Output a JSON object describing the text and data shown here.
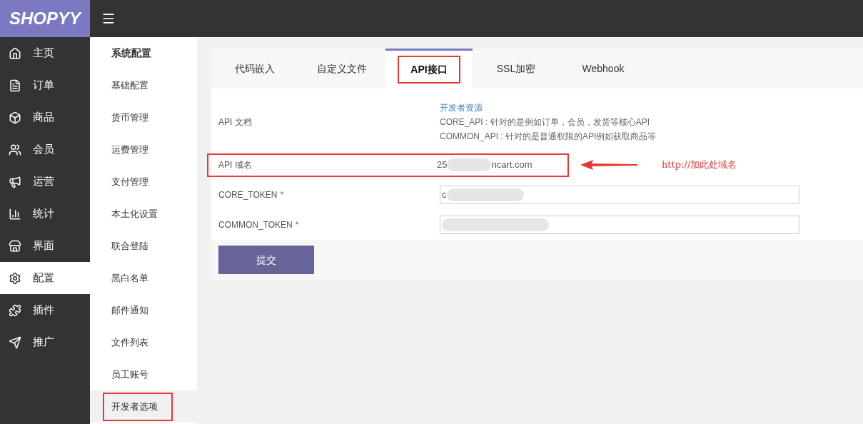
{
  "logo": "SHOPYY",
  "nav": [
    {
      "label": "主页",
      "selected": false
    },
    {
      "label": "订单",
      "selected": false
    },
    {
      "label": "商品",
      "selected": false
    },
    {
      "label": "会员",
      "selected": false
    },
    {
      "label": "运营",
      "selected": false
    },
    {
      "label": "统计",
      "selected": false
    },
    {
      "label": "界面",
      "selected": false
    },
    {
      "label": "配置",
      "selected": true
    },
    {
      "label": "插件",
      "selected": false
    },
    {
      "label": "推广",
      "selected": false
    }
  ],
  "submenu": {
    "title": "系统配置",
    "items": [
      {
        "label": "基础配置",
        "selected": false,
        "annotated": false
      },
      {
        "label": "货币管理",
        "selected": false,
        "annotated": false
      },
      {
        "label": "运费管理",
        "selected": false,
        "annotated": false
      },
      {
        "label": "支付管理",
        "selected": false,
        "annotated": false
      },
      {
        "label": "本土化设置",
        "selected": false,
        "annotated": false
      },
      {
        "label": "联合登陆",
        "selected": false,
        "annotated": false
      },
      {
        "label": "黑白名单",
        "selected": false,
        "annotated": false
      },
      {
        "label": "邮件通知",
        "selected": false,
        "annotated": false
      },
      {
        "label": "文件列表",
        "selected": false,
        "annotated": false
      },
      {
        "label": "员工账号",
        "selected": false,
        "annotated": false
      },
      {
        "label": "开发者选项",
        "selected": true,
        "annotated": true
      }
    ]
  },
  "tabs": [
    {
      "label": "代码嵌入",
      "selected": false,
      "annotated": false
    },
    {
      "label": "自定义文件",
      "selected": false,
      "annotated": false
    },
    {
      "label": "API接口",
      "selected": true,
      "annotated": true
    },
    {
      "label": "SSL加密",
      "selected": false,
      "annotated": false
    },
    {
      "label": "Webhook",
      "selected": false,
      "annotated": false
    }
  ],
  "form": {
    "rows": [
      {
        "kind": "doc",
        "label": "API 文档",
        "link": "开发者资源",
        "lines": [
          "CORE_API : 针对的是例如订单，会员，发货等核心API",
          "COMMON_API : 针对的是普通权限的API例如获取商品等"
        ]
      },
      {
        "kind": "text",
        "label": "API 域名",
        "value_start": "25",
        "value_end": "ncart.com",
        "annotated": true
      },
      {
        "kind": "input",
        "label": "CORE_TOKEN",
        "required_mark": "*",
        "value": "c"
      },
      {
        "kind": "input",
        "label": "COMMON_TOKEN",
        "required_mark": "*"
      }
    ]
  },
  "submit": "提交",
  "annotation": "http://加此处域名"
}
